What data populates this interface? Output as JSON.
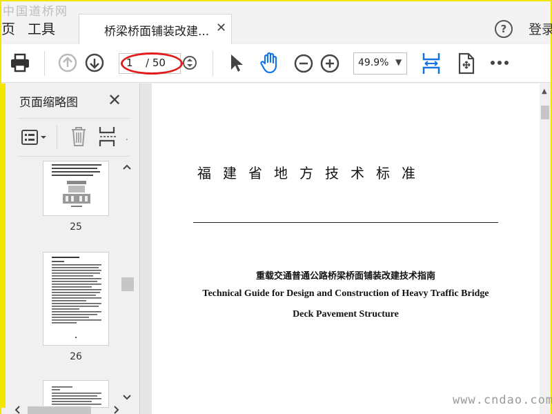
{
  "watermarks": {
    "top": "中国道桥网",
    "bottom": "www.cndao.com"
  },
  "tabbar": {
    "menu_left": "页",
    "menu_tools": "工具",
    "doc_tab_title": "桥梁桥面铺装改建...",
    "login": "登录"
  },
  "toolbar": {
    "page_current": "1",
    "page_total": "/ 50",
    "zoom": "49.9%"
  },
  "left_panel": {
    "title": "页面缩略图",
    "thumbnails": [
      {
        "label": "25"
      },
      {
        "label": "26"
      }
    ]
  },
  "document": {
    "title_cn": "福建省地方技术标准",
    "guide_cn": "重载交通普通公路桥梁桥面铺装改建技术指南",
    "guide_en_line1": "Technical Guide for Design and Construction of Heavy Traffic Bridge",
    "guide_en_line2": "Deck Pavement Structure"
  },
  "colors": {
    "highlight_ring": "#e01c1c",
    "accent_blue": "#1473e6",
    "frame_yellow": "#f2e600"
  },
  "icons": [
    "print-icon",
    "previous-page-icon",
    "next-page-icon",
    "page-navigation-icon",
    "select-tool-icon",
    "hand-tool-icon",
    "zoom-out-icon",
    "zoom-in-icon",
    "fit-width-icon",
    "rotate-page-icon",
    "more-tools-icon",
    "help-icon",
    "close-icon",
    "thumbnail-options-icon",
    "delete-icon",
    "insert-page-icon"
  ]
}
